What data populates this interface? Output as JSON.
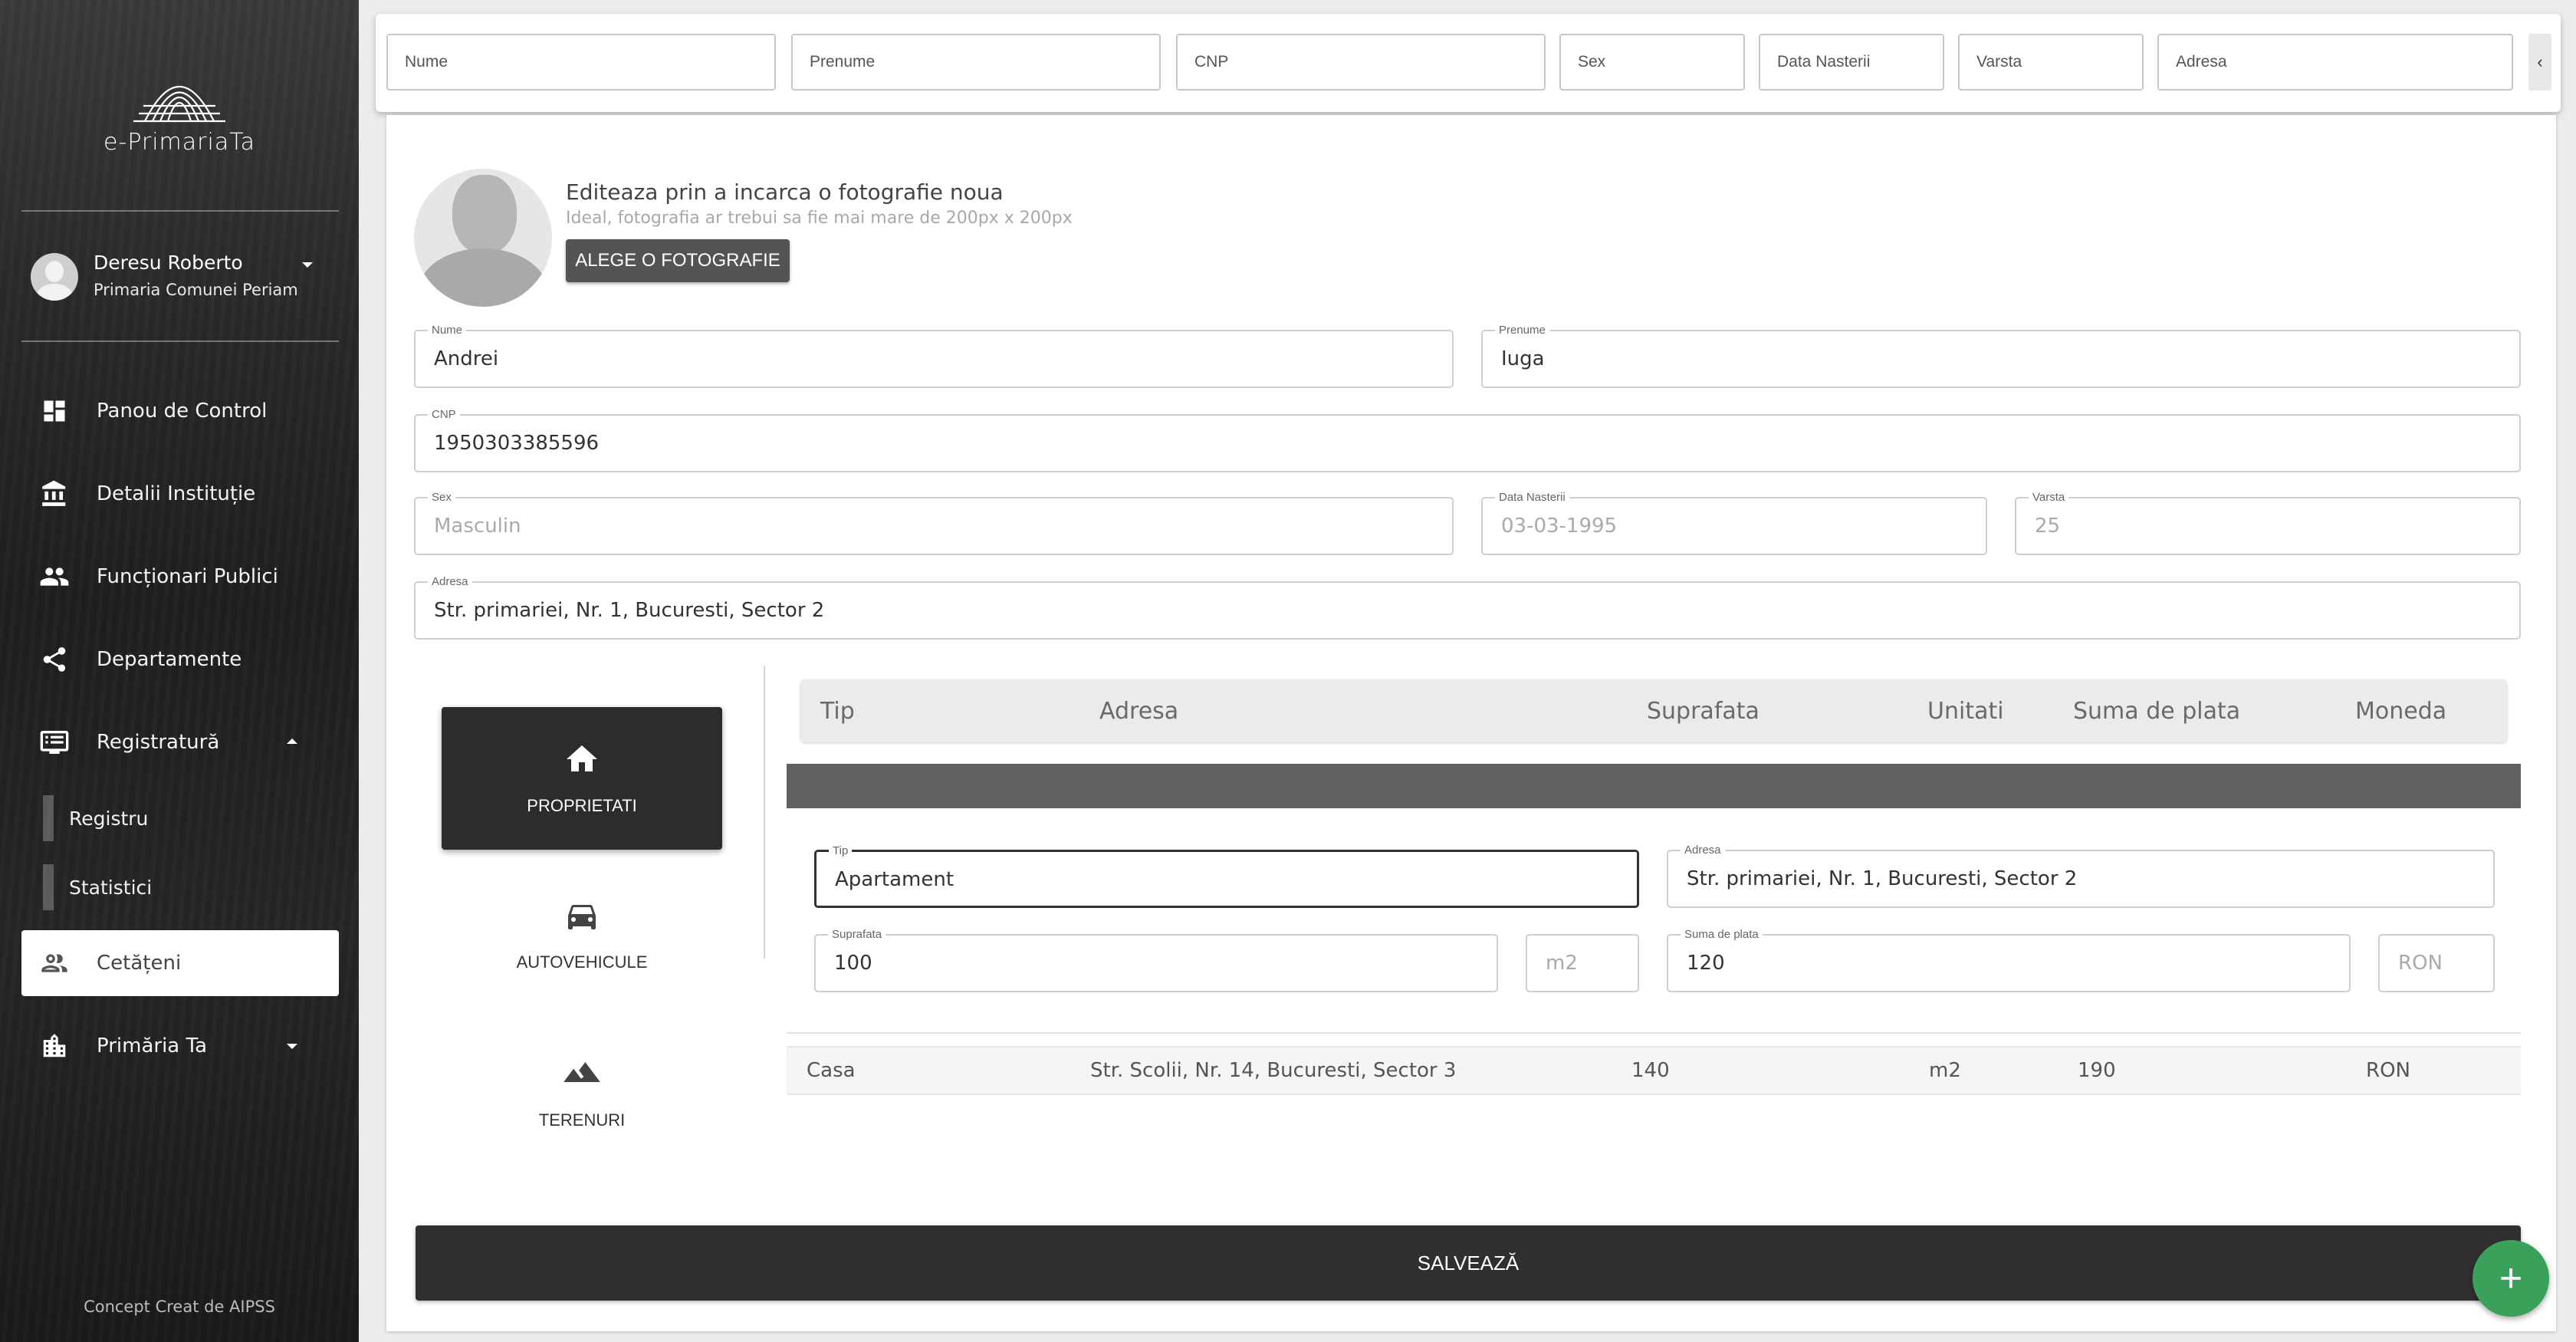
{
  "app": {
    "logo_text": "e-PrimariaTa",
    "credit": "Concept Creat de AIPSS"
  },
  "user": {
    "name": "Deresu Roberto",
    "org": "Primaria Comunei Periam"
  },
  "nav": {
    "items": [
      {
        "label": "Panou de Control",
        "icon": "dashboard-icon"
      },
      {
        "label": "Detalii Instituție",
        "icon": "bank-icon"
      },
      {
        "label": "Funcționari Publici",
        "icon": "people-icon"
      },
      {
        "label": "Departamente",
        "icon": "share-icon"
      },
      {
        "label": "Registratură",
        "icon": "list-icon"
      }
    ],
    "sub": [
      {
        "label": "Registru"
      },
      {
        "label": "Statistici"
      }
    ],
    "active": {
      "label": "Cetățeni"
    },
    "last": {
      "label": "Primăria Ta"
    }
  },
  "filters": [
    "Nume",
    "Prenume",
    "CNP",
    "Sex",
    "Data Nasterii",
    "Varsta",
    "Adresa"
  ],
  "filter_scroll": "‹",
  "photo": {
    "title": "Editeaza prin a incarca o fotografie noua",
    "hint": "Ideal, fotografia ar trebui sa fie mai mare de 200px x 200px",
    "button": "ALEGE O FOTOGRAFIE"
  },
  "form": {
    "nume": {
      "label": "Nume",
      "value": "Andrei"
    },
    "prenume": {
      "label": "Prenume",
      "value": "Iuga"
    },
    "cnp": {
      "label": "CNP",
      "value": "1950303385596"
    },
    "sex": {
      "label": "Sex",
      "value": "Masculin"
    },
    "data": {
      "label": "Data Nasterii",
      "value": "03-03-1995"
    },
    "varsta": {
      "label": "Varsta",
      "value": "25"
    },
    "adresa": {
      "label": "Adresa",
      "value": "Str. primariei, Nr. 1, Bucuresti, Sector 2"
    }
  },
  "tabs": [
    {
      "label": "PROPRIETATI",
      "icon": "home-icon"
    },
    {
      "label": "AUTOVEHICULE",
      "icon": "car-icon"
    },
    {
      "label": "TERENURI",
      "icon": "terrain-icon"
    }
  ],
  "table": {
    "headers": [
      "Tip",
      "Adresa",
      "Suprafata",
      "Unitati",
      "Suma de plata",
      "Moneda"
    ],
    "edit": {
      "tip": {
        "label": "Tip",
        "value": "Apartament"
      },
      "adresa": {
        "label": "Adresa",
        "value": "Str. primariei, Nr. 1, Bucuresti, Sector 2"
      },
      "suprafata": {
        "label": "Suprafata",
        "value": "100"
      },
      "unit": "m2",
      "suma": {
        "label": "Suma de plata",
        "value": "120"
      },
      "moneda": "RON"
    },
    "rows": [
      {
        "tip": "Casa",
        "adresa": "Str. Scolii, Nr. 14, Bucuresti, Sector 3",
        "suprafata": "140",
        "unitati": "m2",
        "suma": "190",
        "moneda": "RON"
      }
    ]
  },
  "save_label": "SALVEAZĂ",
  "fab_label": "+"
}
